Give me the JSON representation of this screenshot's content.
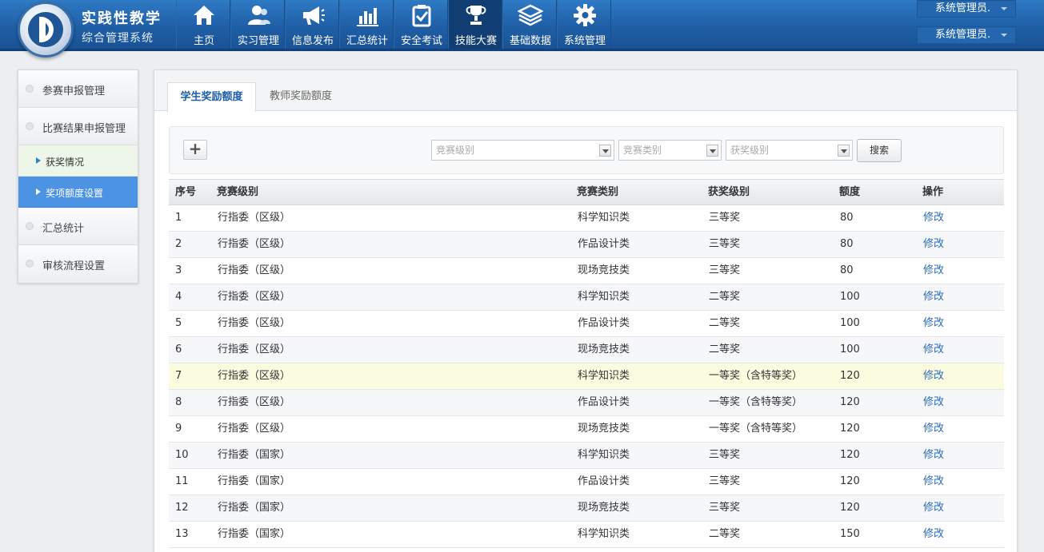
{
  "header": {
    "brand_title": "实践性教学",
    "brand_subtitle": "综合管理系统",
    "nav": [
      {
        "label": "主页",
        "icon": "home-icon",
        "active": false
      },
      {
        "label": "实习管理",
        "icon": "users-icon",
        "active": false
      },
      {
        "label": "信息发布",
        "icon": "megaphone-icon",
        "active": false
      },
      {
        "label": "汇总统计",
        "icon": "bar-chart-icon",
        "active": false
      },
      {
        "label": "安全考试",
        "icon": "checklist-icon",
        "active": false
      },
      {
        "label": "技能大赛",
        "icon": "trophy-icon",
        "active": true
      },
      {
        "label": "基础数据",
        "icon": "layers-icon",
        "active": false
      },
      {
        "label": "系统管理",
        "icon": "gear-icon",
        "active": false
      }
    ],
    "user_dropdowns": [
      "系统管理员.",
      "系统管理员."
    ]
  },
  "sidebar": {
    "items": [
      {
        "label": "参赛申报管理"
      },
      {
        "label": "比赛结果申报管理"
      },
      {
        "label": "获奖情况",
        "sub": true
      },
      {
        "label": "奖项额度设置",
        "sub": true,
        "active": true
      },
      {
        "label": "汇总统计"
      },
      {
        "label": "审核流程设置"
      }
    ]
  },
  "tabs": [
    {
      "label": "学生奖励额度",
      "active": true
    },
    {
      "label": "教师奖励额度",
      "active": false
    }
  ],
  "filters": {
    "add_label": "+",
    "level_placeholder": "竞赛级别",
    "type_placeholder": "竞赛类别",
    "award_placeholder": "获奖级别",
    "search_label": "搜索"
  },
  "table": {
    "headers": {
      "no": "序号",
      "level": "竞赛级别",
      "type": "竞赛类别",
      "award": "获奖级别",
      "amount": "额度",
      "op": "操作"
    },
    "rows": [
      {
        "no": "1",
        "level": "行指委（区级）",
        "type": "科学知识类",
        "award": "三等奖",
        "amount": "80",
        "op": "修改"
      },
      {
        "no": "2",
        "level": "行指委（区级）",
        "type": "作品设计类",
        "award": "三等奖",
        "amount": "80",
        "op": "修改"
      },
      {
        "no": "3",
        "level": "行指委（区级）",
        "type": "现场竞技类",
        "award": "三等奖",
        "amount": "80",
        "op": "修改"
      },
      {
        "no": "4",
        "level": "行指委（区级）",
        "type": "科学知识类",
        "award": "二等奖",
        "amount": "100",
        "op": "修改"
      },
      {
        "no": "5",
        "level": "行指委（区级）",
        "type": "作品设计类",
        "award": "二等奖",
        "amount": "100",
        "op": "修改"
      },
      {
        "no": "6",
        "level": "行指委（区级）",
        "type": "现场竞技类",
        "award": "二等奖",
        "amount": "100",
        "op": "修改"
      },
      {
        "no": "7",
        "level": "行指委（区级）",
        "type": "科学知识类",
        "award": "一等奖（含特等奖）",
        "amount": "120",
        "op": "修改"
      },
      {
        "no": "8",
        "level": "行指委（区级）",
        "type": "作品设计类",
        "award": "一等奖（含特等奖）",
        "amount": "120",
        "op": "修改"
      },
      {
        "no": "9",
        "level": "行指委（区级）",
        "type": "现场竞技类",
        "award": "一等奖（含特等奖）",
        "amount": "120",
        "op": "修改"
      },
      {
        "no": "10",
        "level": "行指委（国家）",
        "type": "科学知识类",
        "award": "三等奖",
        "amount": "120",
        "op": "修改"
      },
      {
        "no": "11",
        "level": "行指委（国家）",
        "type": "作品设计类",
        "award": "三等奖",
        "amount": "120",
        "op": "修改"
      },
      {
        "no": "12",
        "level": "行指委（国家）",
        "type": "现场竞技类",
        "award": "三等奖",
        "amount": "120",
        "op": "修改"
      },
      {
        "no": "13",
        "level": "行指委（国家）",
        "type": "科学知识类",
        "award": "二等奖",
        "amount": "150",
        "op": "修改"
      }
    ],
    "highlighted_row": "7"
  }
}
